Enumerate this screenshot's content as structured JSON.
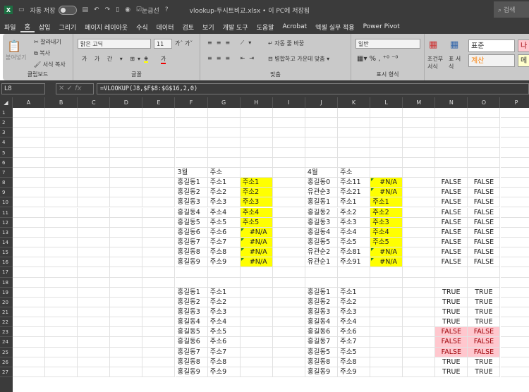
{
  "titlebar": {
    "autosave_label": "자동 저장",
    "autosave_state": "끔",
    "gridlines_label": "눈금선",
    "filename": "vlookup-두시트비교.xlsx • 이 PC에 저장됨",
    "search": "검색"
  },
  "menu": [
    "파일",
    "홈",
    "삽입",
    "그리기",
    "페이지 레이아웃",
    "수식",
    "데이터",
    "검토",
    "보기",
    "개발 도구",
    "도움말",
    "Acrobat",
    "엑셀 실무 적용",
    "Power Pivot"
  ],
  "menu_active": "홈",
  "ribbon": {
    "clipboard": {
      "paste": "붙여넣기",
      "cut": "잘라내기",
      "copy": "복사",
      "format_painter": "서식 복사",
      "label": "클립보드"
    },
    "font": {
      "name": "맑은 고딕",
      "size": "11",
      "label": "글꼴"
    },
    "alignment": {
      "wrap": "자동 줄 바꿈",
      "merge": "병합하고 가운데 맞춤",
      "label": "맞춤"
    },
    "number": {
      "format": "일반",
      "label": "표시 형식"
    },
    "styles": {
      "conditional": "조건부 서식",
      "table": "표 서식",
      "normal": "표준",
      "bad": "나쁨",
      "calc": "계산",
      "memo": "메모"
    }
  },
  "formula_bar": {
    "name_box": "L8",
    "formula": "=VLOOKUP(J8,$F$8:$G$16,2,0)"
  },
  "columns": [
    "A",
    "B",
    "C",
    "D",
    "E",
    "F",
    "G",
    "H",
    "I",
    "J",
    "K",
    "L",
    "M",
    "N",
    "O",
    "P"
  ],
  "rows": 27,
  "colors": {
    "yellow": "#ffff00",
    "pink": "#ffc7ce",
    "pink_text": "#9c0006"
  },
  "cells": {
    "7": {
      "F": "3월",
      "G": "주소",
      "J": "4월",
      "K": "주소"
    },
    "8": {
      "F": "홍길동1",
      "G": "주소1",
      "H": "주소1",
      "J": "홍길동0",
      "K": "주소11",
      "L": "#N/A",
      "N": "FALSE",
      "O": "FALSE"
    },
    "9": {
      "F": "홍길동2",
      "G": "주소2",
      "H": "주소2",
      "J": "유관순3",
      "K": "주소21",
      "L": "#N/A",
      "N": "FALSE",
      "O": "FALSE"
    },
    "10": {
      "F": "홍길동3",
      "G": "주소3",
      "H": "주소3",
      "J": "홍길동1",
      "K": "주소1",
      "L": "주소1",
      "N": "FALSE",
      "O": "FALSE"
    },
    "11": {
      "F": "홍길동4",
      "G": "주소4",
      "H": "주소4",
      "J": "홍길동2",
      "K": "주소2",
      "L": "주소2",
      "N": "FALSE",
      "O": "FALSE"
    },
    "12": {
      "F": "홍길동5",
      "G": "주소5",
      "H": "주소5",
      "J": "홍길동3",
      "K": "주소3",
      "L": "주소3",
      "N": "FALSE",
      "O": "FALSE"
    },
    "13": {
      "F": "홍길동6",
      "G": "주소6",
      "H": "#N/A",
      "J": "홍길동4",
      "K": "주소4",
      "L": "주소4",
      "N": "FALSE",
      "O": "FALSE"
    },
    "14": {
      "F": "홍길동7",
      "G": "주소7",
      "H": "#N/A",
      "J": "홍길동5",
      "K": "주소5",
      "L": "주소5",
      "N": "FALSE",
      "O": "FALSE"
    },
    "15": {
      "F": "홍길동8",
      "G": "주소8",
      "H": "#N/A",
      "J": "유관순2",
      "K": "주소81",
      "L": "#N/A",
      "N": "FALSE",
      "O": "FALSE"
    },
    "16": {
      "F": "홍길동9",
      "G": "주소9",
      "H": "#N/A",
      "J": "유관순1",
      "K": "주소91",
      "L": "#N/A",
      "N": "FALSE",
      "O": "FALSE"
    },
    "19": {
      "F": "홍길동1",
      "G": "주소1",
      "J": "홍길동1",
      "K": "주소1",
      "N": "TRUE",
      "O": "TRUE"
    },
    "20": {
      "F": "홍길동2",
      "G": "주소2",
      "J": "홍길동2",
      "K": "주소2",
      "N": "TRUE",
      "O": "TRUE"
    },
    "21": {
      "F": "홍길동3",
      "G": "주소3",
      "J": "홍길동3",
      "K": "주소3",
      "N": "TRUE",
      "O": "TRUE"
    },
    "22": {
      "F": "홍길동4",
      "G": "주소4",
      "J": "홍길동4",
      "K": "주소4",
      "N": "TRUE",
      "O": "TRUE"
    },
    "23": {
      "F": "홍길동5",
      "G": "주소5",
      "J": "홍길동6",
      "K": "주소6",
      "N": "FALSE",
      "O": "FALSE"
    },
    "24": {
      "F": "홍길동6",
      "G": "주소6",
      "J": "홍길동7",
      "K": "주소7",
      "N": "FALSE",
      "O": "FALSE"
    },
    "25": {
      "F": "홍길동7",
      "G": "주소7",
      "J": "홍길동5",
      "K": "주소5",
      "N": "FALSE",
      "O": "FALSE"
    },
    "26": {
      "F": "홍길동8",
      "G": "주소8",
      "J": "홍길동8",
      "K": "주소8",
      "N": "TRUE",
      "O": "TRUE"
    },
    "27": {
      "F": "홍길동9",
      "G": "주소9",
      "J": "홍길동9",
      "K": "주소9",
      "N": "TRUE",
      "O": "TRUE"
    }
  },
  "highlight": {
    "yellow": [
      "H8:H16",
      "L8:L16"
    ],
    "pink": [
      "N23:O25"
    ]
  }
}
